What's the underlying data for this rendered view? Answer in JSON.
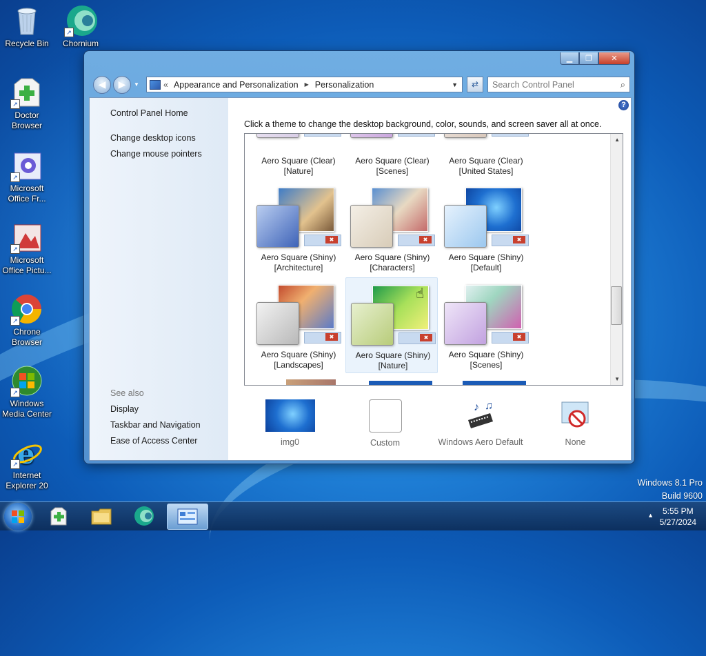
{
  "desktop": {
    "icons": [
      {
        "label": "Recycle Bin"
      },
      {
        "label": "Chornium"
      },
      {
        "label": "Doctor Browser"
      },
      {
        "label": "Microsoft Office Fr..."
      },
      {
        "label": "Microsoft Office Pictu..."
      },
      {
        "label": "Chrone Browser"
      },
      {
        "label": "Windows Media Center"
      },
      {
        "label": "Internet Explorer 20"
      }
    ],
    "watermark": {
      "line1": "Windows 8.1 Pro",
      "line2": "Build 9600"
    }
  },
  "window": {
    "breadcrumb": [
      "Appearance and Personalization",
      "Personalization"
    ],
    "breadcrumb_prefix": "«",
    "search_placeholder": "Search Control Panel",
    "sidebar": {
      "home": "Control Panel Home",
      "links": [
        "Change desktop icons",
        "Change mouse pointers"
      ],
      "see_also_title": "See also",
      "see_also": [
        "Display",
        "Taskbar and Navigation",
        "Ease of Access Center"
      ]
    },
    "intro": "Click a theme to change the desktop background, color, sounds, and screen saver all at once.",
    "themes": [
      {
        "name": "Aero Square (Clear)",
        "sub": "[Nature]"
      },
      {
        "name": "Aero Square (Clear)",
        "sub": "[Scenes]"
      },
      {
        "name": "Aero Square (Clear)",
        "sub": "[United States]"
      },
      {
        "name": "Aero Square (Shiny)",
        "sub": "[Architecture]"
      },
      {
        "name": "Aero Square (Shiny)",
        "sub": "[Characters]"
      },
      {
        "name": "Aero Square (Shiny)",
        "sub": "[Default]"
      },
      {
        "name": "Aero Square (Shiny)",
        "sub": "[Landscapes]"
      },
      {
        "name": "Aero Square (Shiny)",
        "sub": "[Nature]",
        "selected": true
      },
      {
        "name": "Aero Square (Shiny)",
        "sub": "[Scenes]"
      }
    ],
    "bottom_items": [
      {
        "label": "img0",
        "icon": "desktop-background-icon"
      },
      {
        "label": "Custom",
        "icon": "color-swatch-icon"
      },
      {
        "label": "Windows Aero Default",
        "icon": "sounds-icon"
      },
      {
        "label": "None",
        "icon": "screen-saver-icon"
      }
    ],
    "caption": {
      "minimize": "▁",
      "maximize": "❐",
      "close": "✕"
    }
  },
  "taskbar": {
    "time": "5:55 PM",
    "date": "5/27/2024",
    "tray_arrow": "▲"
  }
}
